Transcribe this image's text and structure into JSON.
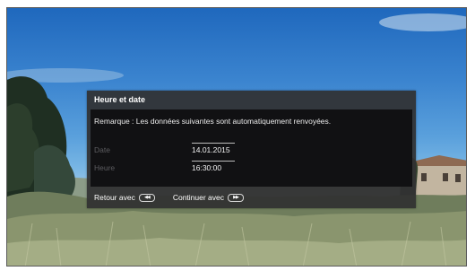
{
  "dialog": {
    "title": "Heure et date",
    "note": "Remarque : Les données suivantes sont automatiquement renvoyées.",
    "rows": [
      {
        "label": "Date",
        "value": "14.01.2015"
      },
      {
        "label": "Heure",
        "value": "16:30:00"
      }
    ],
    "footer": {
      "back_label": "Retour avec",
      "back_icon": "rewind-icon",
      "continue_label": "Continuer avec",
      "continue_icon": "fast-forward-icon"
    }
  }
}
